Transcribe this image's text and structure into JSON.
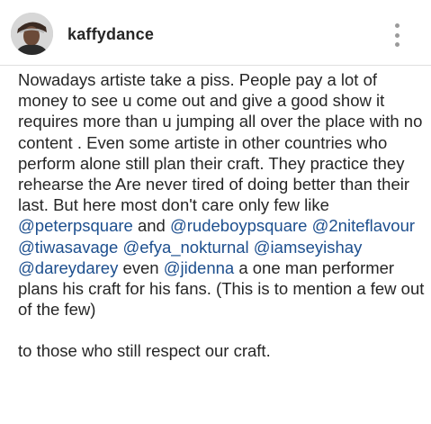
{
  "post": {
    "username": "kaffydance",
    "more_icon": "more-vertical-icon",
    "avatar_icon": "profile-photo-avatar"
  },
  "caption": {
    "text_1": "Nowadays artiste take a piss. People pay a lot of money to see u come out and give a good show it requires more than u jumping all over the place with no content . Even some artiste in other countries who perform alone still plan their craft. They practice they rehearse the Are never tired of doing better than their last. But here most don't care only few like ",
    "mention_1": "@peterpsquare",
    "text_2": " and ",
    "mention_2": "@rudeboypsquare",
    "text_3": " ",
    "mention_3": "@2niteflavour",
    "text_4": " ",
    "mention_4": "@tiwasavage",
    "text_5": " ",
    "mention_5": "@efya_nokturnal",
    "text_6": " ",
    "mention_6": "@iamseyishay",
    "text_7": " ",
    "mention_7": "@dareydarey",
    "text_8": " even ",
    "mention_8": "@jidenna",
    "text_9": " a one man performer plans his craft for his fans. (This is to mention a few out of the few)",
    "closing": "to those who still respect our craft."
  },
  "colors": {
    "mention": "#1d4f8e",
    "text": "#262626",
    "more_icon": "#9b9b9b"
  }
}
